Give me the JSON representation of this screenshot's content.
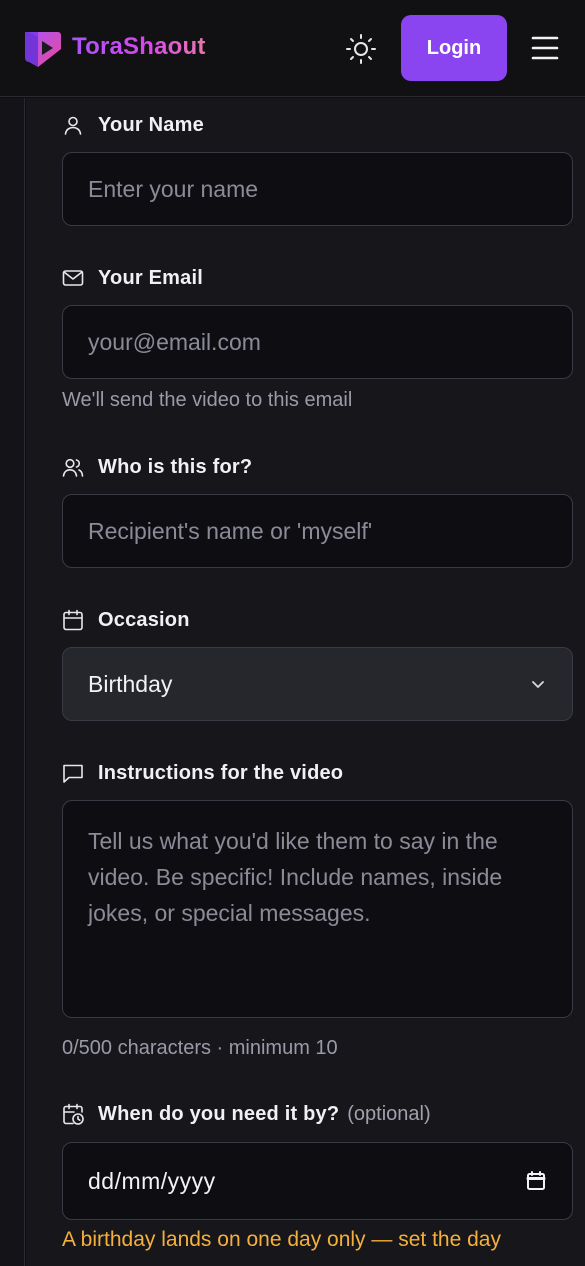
{
  "header": {
    "brand": "ToraShaout",
    "login_label": "Login",
    "logo_icon": "play-bookmark-icon",
    "theme_icon": "sun-icon",
    "menu_icon": "hamburger-menu-icon",
    "accent": "#8b45f0"
  },
  "form": {
    "name": {
      "label": "Your Name",
      "placeholder": "Enter your name",
      "value": "",
      "icon": "user-icon"
    },
    "email": {
      "label": "Your Email",
      "placeholder": "your@email.com",
      "value": "",
      "helper": "We'll send the video to this email",
      "icon": "mail-icon"
    },
    "recipient": {
      "label": "Who is this for?",
      "placeholder": "Recipient's name or 'myself'",
      "value": "",
      "icon": "users-icon"
    },
    "occasion": {
      "label": "Occasion",
      "selected": "Birthday",
      "icon": "calendar-icon"
    },
    "instructions": {
      "label": "Instructions for the video",
      "placeholder": "Tell us what you'd like them to say in the video. Be specific! Include names, inside jokes, or special messages.",
      "value": "",
      "counter": "0/500 characters · minimum 10",
      "icon": "message-square-icon"
    },
    "deadline": {
      "label": "When do you need it by?",
      "optional": "(optional)",
      "value": "dd/mm/yyyy",
      "icon": "calendar-clock-icon",
      "warning": "A birthday lands on one day only — set the day",
      "warning_color": "#f5b03c"
    }
  }
}
